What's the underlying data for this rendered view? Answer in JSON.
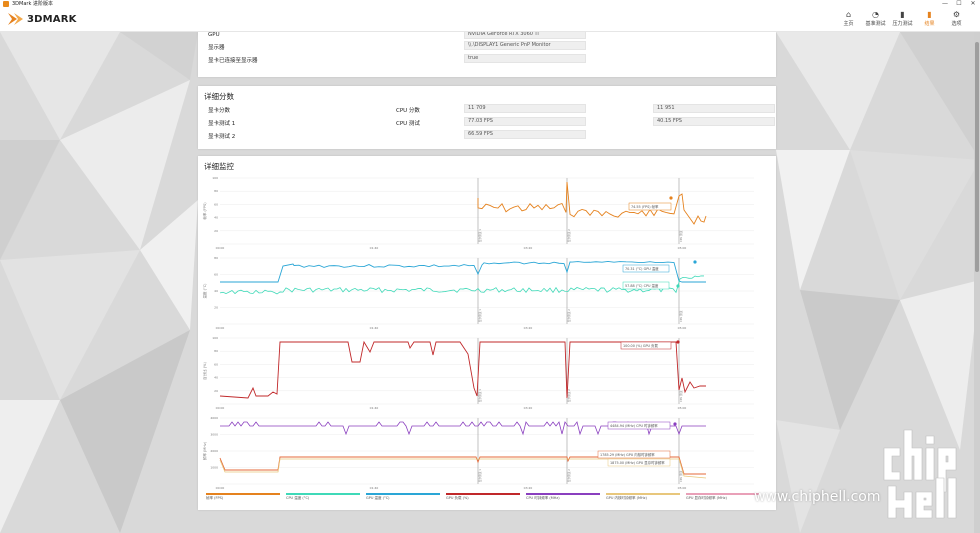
{
  "window": {
    "title": "3DMark 进阶版本",
    "controls": [
      "—",
      "☐",
      "✕"
    ]
  },
  "app": {
    "logo_text": "3DMARK"
  },
  "nav": [
    {
      "label": "主页",
      "icon": "home-icon",
      "glyph": "⌂",
      "active": false
    },
    {
      "label": "基准测试",
      "icon": "gauge-icon",
      "glyph": "◔",
      "active": false
    },
    {
      "label": "压力测试",
      "icon": "bars-chart-icon",
      "glyph": "▮",
      "active": false
    },
    {
      "label": "结果",
      "icon": "results-chart-icon",
      "glyph": "▮",
      "active": true
    },
    {
      "label": "选项",
      "icon": "gear-icon",
      "glyph": "⚙",
      "active": false
    }
  ],
  "system_info": {
    "rows": [
      {
        "label": "GPU",
        "value": "NVIDIA GeForce RTX 3060 Ti"
      },
      {
        "label": "显示器",
        "value": "\\\\.\\DISPLAY1 Generic PnP Monitor"
      },
      {
        "label": "显卡已连接至显示器",
        "value": "true"
      }
    ]
  },
  "scores": {
    "title": "详细分数",
    "left": [
      {
        "label": "显卡分数",
        "value": "11 709"
      },
      {
        "label": "显卡测试 1",
        "value": "77.03 FPS"
      },
      {
        "label": "显卡测试 2",
        "value": "66.59 FPS"
      }
    ],
    "right": [
      {
        "label": "CPU 分数",
        "value": "11 951"
      },
      {
        "label": "CPU 测试",
        "value": "40.15 FPS"
      }
    ]
  },
  "monitoring": {
    "title": "详细监控",
    "colors": {
      "fps": "#e5821e",
      "cpu_temp": "#3fd9b8",
      "gpu_temp": "#2aa6d6",
      "gpu_load": "#c0282a",
      "cpu_clock": "#8a3fbf",
      "gpu_core_clock": "#e46a3a",
      "gpu_mem_clock": "#e8c77c"
    },
    "tooltips": {
      "fps": "74.55 (FPS) 帧率",
      "gpu_temp": "70.31 (°C) GPU 温度",
      "cpu_temp": "57.88 (°C) CPU 温度",
      "gpu_load": "100.00 (%) GPU 负载",
      "cpu_clock": "4484.94 (MHz) CPU 时钟频率",
      "gpu_core": "1785.29 (MHz) GPU 内核时钟频率",
      "gpu_mem": "1875.00 (MHz) GPU 显存时钟频率"
    },
    "axis": {
      "fps_label": "帧率 (FPS)",
      "temp_label": "温度 (°C)",
      "load_label": "百分比 (%)",
      "clock_label": "频率 (MHz)",
      "fps_ticks": [
        "100",
        "80",
        "60",
        "40",
        "20"
      ],
      "temp_ticks": [
        "80",
        "60",
        "40",
        "20"
      ],
      "load_ticks": [
        "100",
        "80",
        "60",
        "40",
        "20"
      ],
      "clock_ticks": [
        "4000",
        "3000",
        "2000",
        "1000"
      ],
      "time_ticks": [
        "00:00",
        "01:40",
        "03:20",
        "05:00"
      ],
      "markers": [
        "显卡测试 1",
        "显卡测试 2",
        "CPU 测试"
      ]
    },
    "legend": [
      {
        "label": "帧率 (FPS)",
        "color": "#e5821e"
      },
      {
        "label": "CPU 温度 (°C)",
        "color": "#3fd9b8"
      },
      {
        "label": "GPU 温度 (°C)",
        "color": "#2aa6d6"
      },
      {
        "label": "GPU 负载 (%)",
        "color": "#c0282a"
      },
      {
        "label": "CPU 时钟频率 (MHz)",
        "color": "#8a3fbf"
      },
      {
        "label": "GPU 内核时钟频率 (MHz)",
        "color": "#e8c77c"
      },
      {
        "label": "GPU 显存时钟频率 (MHz)",
        "color": "#e9a0b8"
      }
    ]
  },
  "watermark": {
    "text": "www.chiphell.com",
    "logo": "chiphell-logo"
  }
}
